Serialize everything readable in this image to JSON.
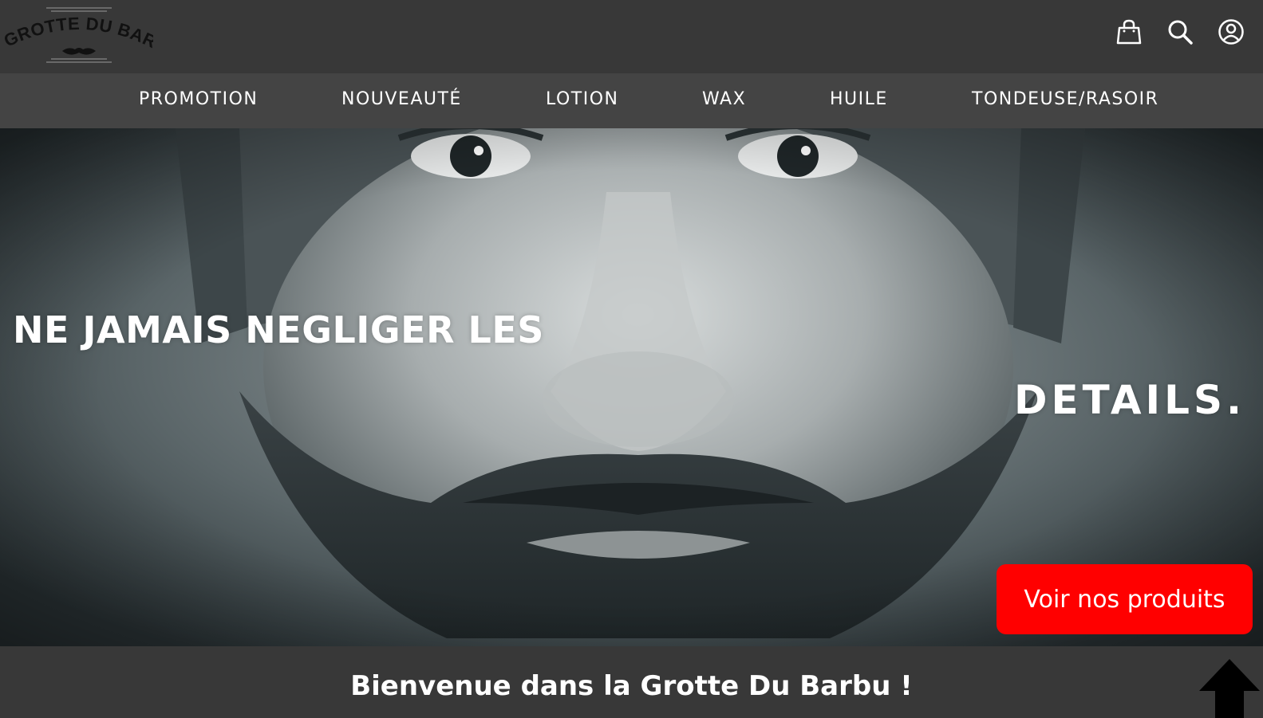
{
  "brand": {
    "logo_text": "LA GROTTE DU BARBU"
  },
  "header": {
    "icons": [
      "shopping-bag-icon",
      "search-icon",
      "account-icon"
    ]
  },
  "nav": {
    "items": [
      {
        "label": "PROMOTION"
      },
      {
        "label": "NOUVEAUTÉ"
      },
      {
        "label": "LOTION"
      },
      {
        "label": "WAX"
      },
      {
        "label": "HUILE"
      },
      {
        "label": "TONDEUSE/RASOIR"
      }
    ]
  },
  "hero": {
    "headline_left": "NE JAMAIS NEGLIGER LES",
    "headline_right": "DETAILS.",
    "cta_label": "Voir nos produits",
    "cta_color": "#ff0000"
  },
  "welcome": {
    "title": "Bienvenue dans la Grotte Du Barbu !"
  },
  "colors": {
    "header_bg": "#383838",
    "nav_bg": "#444444",
    "text": "#ffffff"
  }
}
